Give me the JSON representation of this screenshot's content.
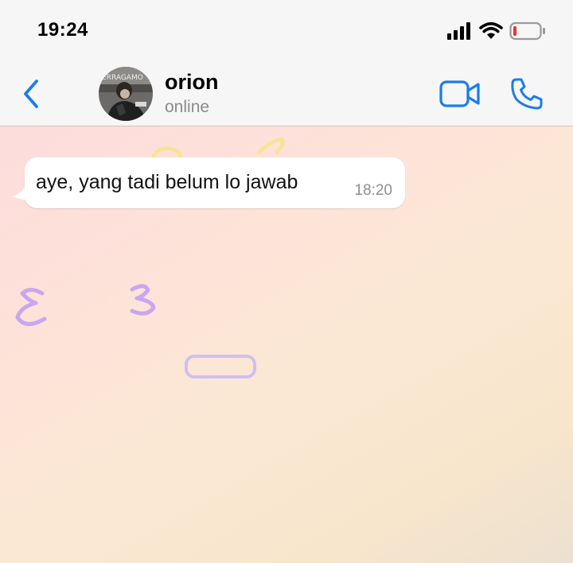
{
  "status_bar": {
    "time": "19:24",
    "icons": [
      "signal-icon",
      "wifi-icon",
      "battery-icon"
    ]
  },
  "header": {
    "contact_name": "orion",
    "contact_status": "online",
    "icons": [
      "back-chevron-icon",
      "video-camera-icon",
      "phone-icon"
    ],
    "accent_color": "#1a7cf0"
  },
  "messages": [
    {
      "direction": "incoming",
      "text": "aye, yang tadi belum lo jawab",
      "time": "18:20"
    }
  ],
  "colors": {
    "bar_background": "#f6f6f6",
    "bubble_incoming": "#ffffff",
    "battery_low": "#e53935"
  }
}
